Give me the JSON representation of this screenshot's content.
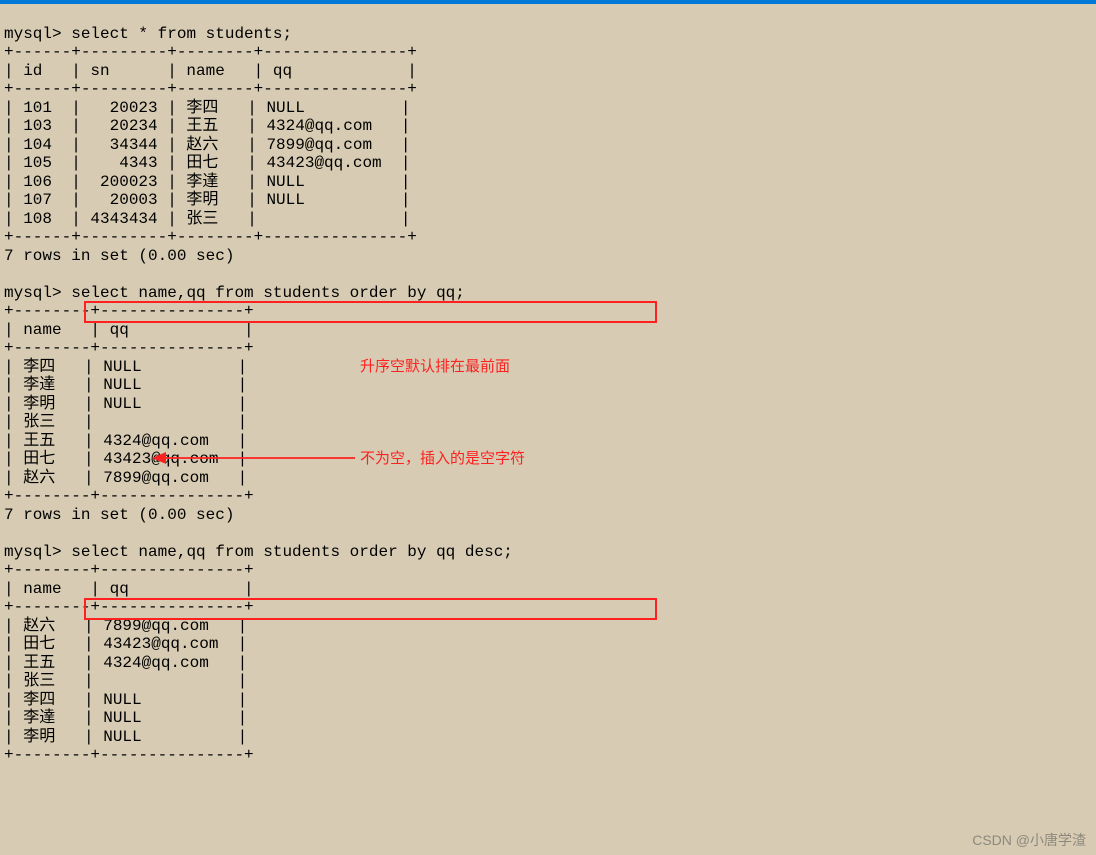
{
  "prompt": "mysql>",
  "query1": "select * from students;",
  "sep1_top": "+------+---------+--------+---------------+",
  "hdr1": "| id   | sn      | name   | qq            |",
  "rows1": [
    "| 101  |   20023 | 李四   | NULL          |",
    "| 103  |   20234 | 王五   | 4324@qq.com   |",
    "| 104  |   34344 | 赵六   | 7899@qq.com   |",
    "| 105  |    4343 | 田七   | 43423@qq.com  |",
    "| 106  |  200023 | 李達   | NULL          |",
    "| 107  |   20003 | 李明   | NULL          |",
    "| 108  | 4343434 | 张三   |               |"
  ],
  "footer1": "7 rows in set (0.00 sec)",
  "query2": "select name,qq from students order by qq;",
  "sep2_top": "+--------+---------------+",
  "hdr2": "| name   | qq            |",
  "rows2": [
    "| 李四   | NULL          |",
    "| 李達   | NULL          |",
    "| 李明   | NULL          |",
    "| 张三   |               |",
    "| 王五   | 4324@qq.com   |",
    "| 田七   | 43423@qq.com  |",
    "| 赵六   | 7899@qq.com   |"
  ],
  "footer2": "7 rows in set (0.00 sec)",
  "query3": "select name,qq from students order by qq desc;",
  "rows3": [
    "| 赵六   | 7899@qq.com   |",
    "| 田七   | 43423@qq.com  |",
    "| 王五   | 4324@qq.com   |",
    "| 张三   |               |",
    "| 李四   | NULL          |",
    "| 李達   | NULL          |",
    "| 李明   | NULL          |"
  ],
  "anno1": "升序空默认排在最前面",
  "anno2": "不为空，插入的是空字符",
  "watermark": "CSDN @小唐学渣"
}
